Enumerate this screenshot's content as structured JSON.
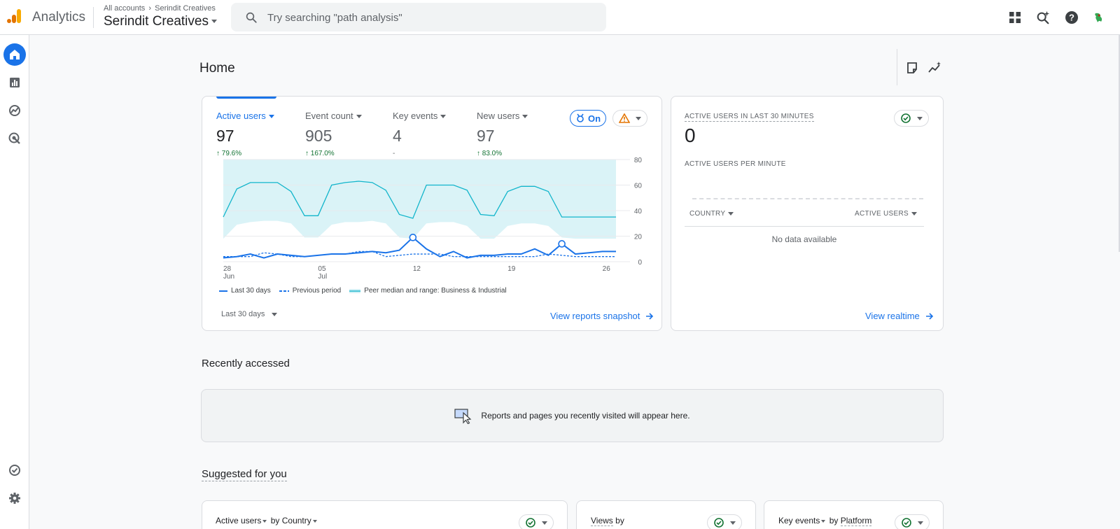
{
  "topbar": {
    "app_name": "Analytics",
    "breadcrumb_root": "All accounts",
    "breadcrumb_current": "Serindit Creatives",
    "account_name": "Serindit Creatives",
    "search_placeholder": "Try searching \"path analysis\""
  },
  "icons": {
    "apps": "apps-grid-icon",
    "search_insights": "search-sparkle-icon",
    "help": "help-icon",
    "account": "account-avatar-icon"
  },
  "nav": [
    "home-icon",
    "reports-icon",
    "explore-icon",
    "advertising-icon",
    "admin-check-icon",
    "settings-icon"
  ],
  "page": {
    "title": "Home"
  },
  "overview": {
    "metrics": [
      {
        "label": "Active users",
        "value": "97",
        "change": "79.6%"
      },
      {
        "label": "Event count",
        "value": "905",
        "change": "167.0%"
      },
      {
        "label": "Key events",
        "value": "4",
        "change": "-"
      },
      {
        "label": "New users",
        "value": "97",
        "change": "83.0%"
      }
    ],
    "benchmark_label": "On",
    "legend": [
      "Last 30 days",
      "Previous period",
      "Peer median and range: Business & Industrial"
    ],
    "date_range": "Last 30 days",
    "link": "View reports snapshot"
  },
  "chart_data": {
    "type": "line",
    "x_ticks": [
      {
        "label": "28",
        "sub": "Jun"
      },
      {
        "label": "05",
        "sub": "Jul"
      },
      {
        "label": "12",
        "sub": ""
      },
      {
        "label": "19",
        "sub": ""
      },
      {
        "label": "26",
        "sub": ""
      }
    ],
    "y_ticks": [
      "80",
      "60",
      "40",
      "20",
      "0"
    ],
    "ylim": [
      0,
      80
    ],
    "x_dates": [
      "06-28",
      "06-29",
      "06-30",
      "07-01",
      "07-02",
      "07-03",
      "07-04",
      "07-05",
      "07-06",
      "07-07",
      "07-08",
      "07-09",
      "07-10",
      "07-11",
      "07-12",
      "07-13",
      "07-14",
      "07-15",
      "07-16",
      "07-17",
      "07-18",
      "07-19",
      "07-20",
      "07-21",
      "07-22",
      "07-23",
      "07-24",
      "07-25",
      "07-26",
      "07-27"
    ],
    "series": [
      {
        "name": "Last 30 days",
        "values": [
          3,
          4,
          6,
          3,
          6,
          5,
          4,
          5,
          6,
          6,
          7,
          8,
          7,
          9,
          19,
          10,
          4,
          8,
          3,
          5,
          5,
          6,
          6,
          10,
          5,
          14,
          6,
          7,
          8,
          8
        ]
      },
      {
        "name": "Previous period",
        "values": [
          4,
          4,
          4,
          7,
          6,
          4,
          4,
          5,
          6,
          6,
          8,
          8,
          4,
          5,
          6,
          6,
          6,
          4,
          4,
          4,
          4,
          4,
          4,
          4,
          6,
          5,
          4,
          4,
          4,
          4
        ]
      }
    ],
    "peer_median": [
      35,
      57,
      62,
      62,
      62,
      55,
      36,
      36,
      60,
      62,
      63,
      62,
      56,
      37,
      34,
      60,
      60,
      60,
      56,
      37,
      36,
      55,
      59,
      59,
      55,
      35,
      35,
      35,
      35,
      35
    ],
    "peer_range": [
      {
        "low": 18,
        "high": 80
      },
      {
        "low": 29,
        "high": 80
      },
      {
        "low": 31,
        "high": 80
      },
      {
        "low": 32,
        "high": 80
      },
      {
        "low": 32,
        "high": 80
      },
      {
        "low": 30,
        "high": 80
      },
      {
        "low": 19,
        "high": 80
      },
      {
        "low": 19,
        "high": 80
      },
      {
        "low": 29,
        "high": 80
      },
      {
        "low": 31,
        "high": 80
      },
      {
        "low": 31,
        "high": 80
      },
      {
        "low": 32,
        "high": 80
      },
      {
        "low": 30,
        "high": 80
      },
      {
        "low": 19,
        "high": 80
      },
      {
        "low": 18,
        "high": 80
      },
      {
        "low": 30,
        "high": 80
      },
      {
        "low": 31,
        "high": 80
      },
      {
        "low": 31,
        "high": 80
      },
      {
        "low": 28,
        "high": 80
      },
      {
        "low": 18,
        "high": 80
      },
      {
        "low": 18,
        "high": 80
      },
      {
        "low": 28,
        "high": 80
      },
      {
        "low": 30,
        "high": 80
      },
      {
        "low": 30,
        "high": 80
      },
      {
        "low": 28,
        "high": 80
      },
      {
        "low": 19,
        "high": 80
      },
      {
        "low": 18,
        "high": 80
      },
      {
        "low": 18,
        "high": 80
      },
      {
        "low": 18,
        "high": 80
      },
      {
        "low": 18,
        "high": 80
      }
    ],
    "anomaly_points": [
      "07-12",
      "07-23"
    ],
    "grid": true
  },
  "realtime": {
    "title": "ACTIVE USERS IN LAST 30 MINUTES",
    "value": "0",
    "subtitle": "ACTIVE USERS PER MINUTE",
    "col_country": "COUNTRY",
    "col_users": "ACTIVE USERS",
    "empty": "No data available",
    "link": "View realtime"
  },
  "recent": {
    "title": "Recently accessed",
    "message": "Reports and pages you recently visited will appear here."
  },
  "suggested": {
    "title": "Suggested for you",
    "cards": [
      {
        "metric": "Active users",
        "by": "by",
        "dim": "Country"
      },
      {
        "metric": "Views",
        "by": "by",
        "dim": ""
      },
      {
        "metric": "Key events",
        "by": "by",
        "dim": "Platform"
      }
    ]
  },
  "colors": {
    "accent": "#1a73e8",
    "positive": "#137333",
    "peer": "#12b5cb"
  }
}
